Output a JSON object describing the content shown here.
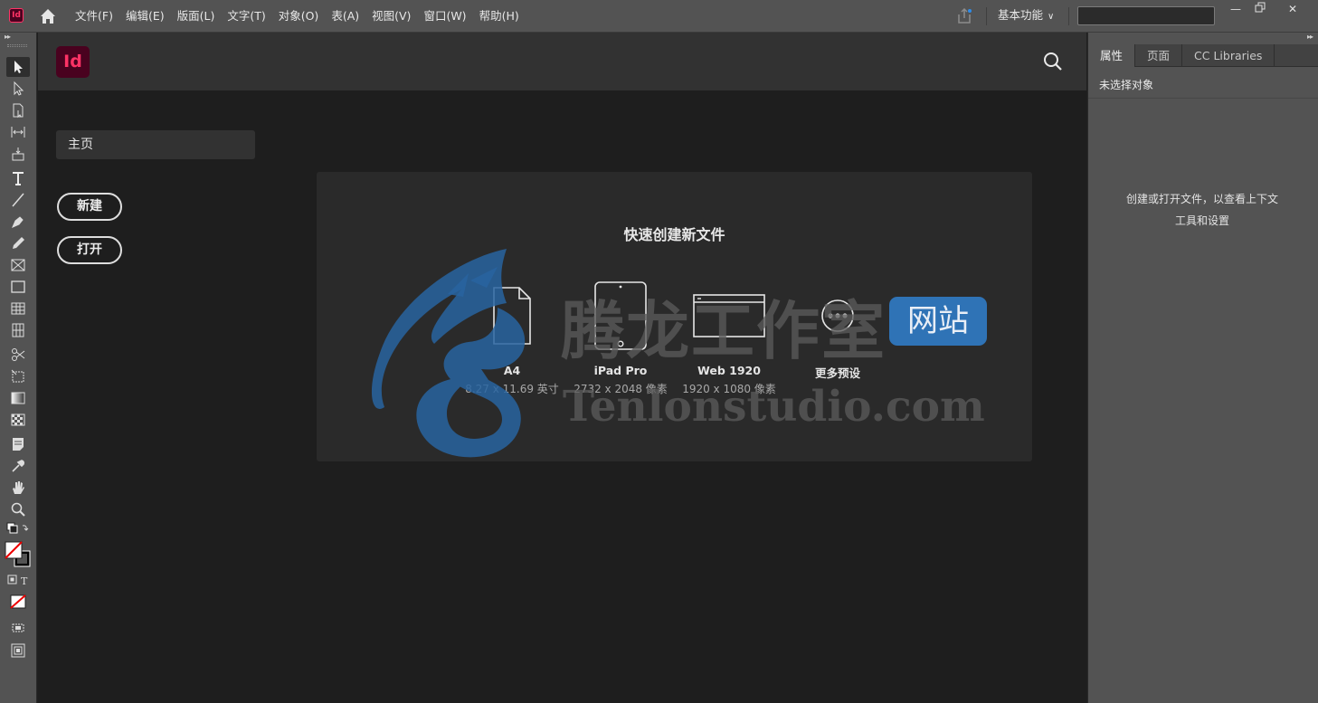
{
  "app": {
    "badge": "Id",
    "logo": "Id"
  },
  "menus": [
    "文件(F)",
    "编辑(E)",
    "版面(L)",
    "文字(T)",
    "对象(O)",
    "表(A)",
    "视图(V)",
    "窗口(W)",
    "帮助(H)"
  ],
  "workspace": {
    "label": "基本功能"
  },
  "search": {
    "value": "",
    "placeholder": ""
  },
  "home": {
    "nav_item": "主页",
    "new_label": "新建",
    "open_label": "打开",
    "quick_create_title": "快速创建新文件",
    "presets": [
      {
        "name": "A4",
        "size": "8.27 x 11.69 英寸"
      },
      {
        "name": "iPad Pro",
        "size": "2732 x 2048 像素"
      },
      {
        "name": "Web 1920",
        "size": "1920 x 1080 像素"
      },
      {
        "name": "更多预设",
        "size": ""
      }
    ]
  },
  "watermark": {
    "cn": "腾龙工作室",
    "en": "Tenlonstudio.com",
    "badge": "网站"
  },
  "panel": {
    "tabs": [
      "属性",
      "页面",
      "CC Libraries"
    ],
    "status": "未选择对象",
    "hint_line1": "创建或打开文件，以查看上下文",
    "hint_line2": "工具和设置"
  },
  "colors": {
    "indesign_accent": "#ff3366",
    "indesign_bg": "#49021f",
    "watermark_blue": "#2f73b6"
  }
}
